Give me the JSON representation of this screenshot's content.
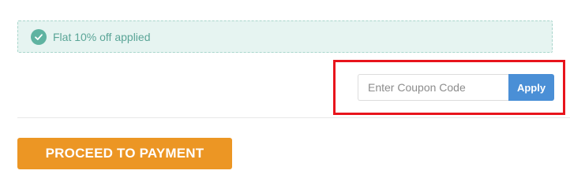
{
  "discount": {
    "message": "Flat 10% off applied",
    "icon": "check-circle-icon",
    "color": "#5fb3a1"
  },
  "coupon": {
    "placeholder": "Enter Coupon Code",
    "value": "",
    "apply_label": "Apply",
    "apply_color": "#4a8fd6"
  },
  "highlight": {
    "color": "#e8141c"
  },
  "payment": {
    "label": "PROCEED TO PAYMENT",
    "color": "#ec9624"
  }
}
